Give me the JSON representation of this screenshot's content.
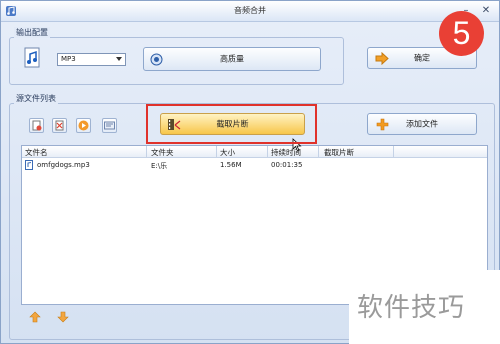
{
  "window": {
    "title": "音频合并"
  },
  "output_config": {
    "group_label": "输出配置",
    "format_select_value": "MP3",
    "quality_button_label": "高质量",
    "confirm_button_label": "确定"
  },
  "source_list": {
    "group_label": "源文件列表",
    "clip_button_label": "截取片断",
    "add_file_button_label": "添加文件",
    "columns": [
      "文件名",
      "文件夹",
      "大小",
      "持续时间",
      "截取片断"
    ],
    "rows": [
      {
        "filename": "omfgdogs.mp3",
        "folder": "E:\\乐",
        "size": "1.56M",
        "duration": "00:01:35",
        "clip": ""
      }
    ]
  },
  "overlay": {
    "step_badge": "5",
    "watermark": "软件技巧"
  },
  "colors": {
    "highlight": "#e0322b",
    "badge": "#e94035",
    "accent_button": "#f7c64a"
  }
}
